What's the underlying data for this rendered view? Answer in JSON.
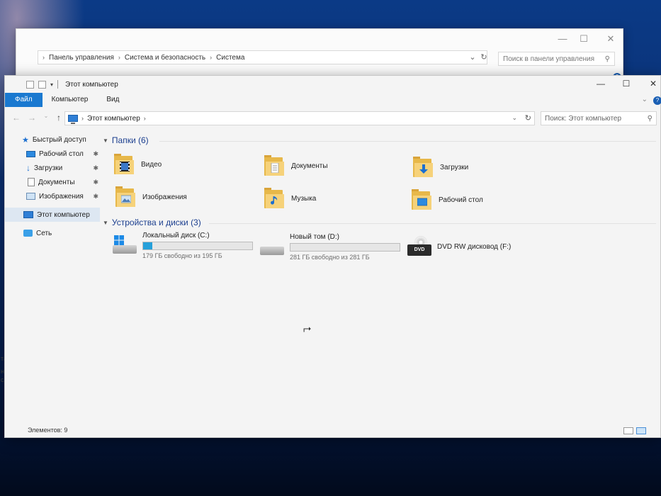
{
  "control_panel": {
    "breadcrumb": [
      "Панель управления",
      "Система и безопасность",
      "Система"
    ],
    "search_placeholder": "Поиск в панели управления",
    "left_fragments": [
      "такж",
      "нтр бе",
      "служ"
    ]
  },
  "explorer": {
    "title": "Этот компьютер",
    "ribbon_tabs": [
      "Файл",
      "Компьютер",
      "Вид"
    ],
    "address": "Этот компьютер",
    "search_placeholder": "Поиск: Этот компьютер",
    "sidebar": {
      "quick_access": "Быстрый доступ",
      "items": [
        "Рабочий стол",
        "Загрузки",
        "Документы",
        "Изображения"
      ],
      "this_pc": "Этот компьютер",
      "network": "Сеть"
    },
    "folders_header": "Папки (6)",
    "folders": [
      "Видео",
      "Документы",
      "Загрузки",
      "Изображения",
      "Музыка",
      "Рабочий стол"
    ],
    "devices_header": "Устройства и диски (3)",
    "drives": [
      {
        "name": "Локальный диск (C:)",
        "free": "179 ГБ свободно из 195 ГБ",
        "used_fraction": 0.082
      },
      {
        "name": "Новый том (D:)",
        "free": "281 ГБ свободно из 281 ГБ",
        "used_fraction": 0.0
      },
      {
        "name": "DVD RW дисковод (F:)"
      }
    ],
    "dvd_label": "DVD",
    "status": "Элементов: 9"
  },
  "colors": {
    "accent": "#1a79d0",
    "folder": "#f6d27a",
    "drive_bar": "#26a0da"
  }
}
